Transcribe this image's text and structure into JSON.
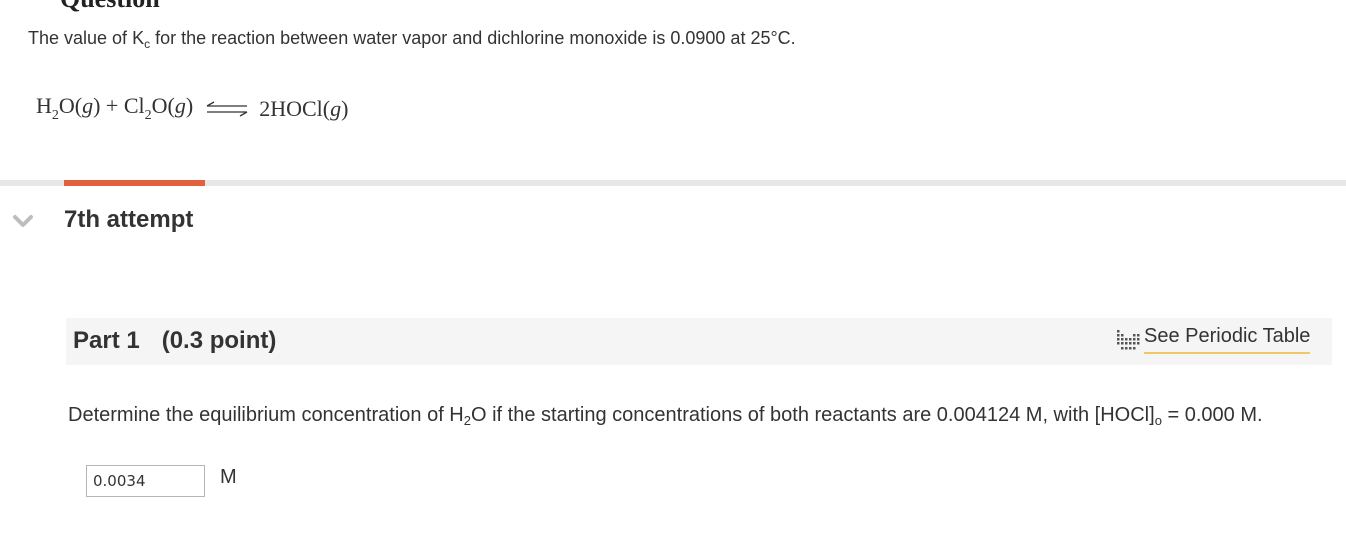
{
  "question_header": {
    "title": "Question"
  },
  "intro": {
    "text_before": "The value of K",
    "k_sub": "c",
    "text_after": " for the reaction between water vapor and dichlorine monoxide is 0.0900 at 25°C."
  },
  "equation": {
    "h": "H",
    "sub2a": "2",
    "o_g": "O(",
    "g1": "g",
    "close1": ") + Cl",
    "sub2b": "2",
    "o2": "O(",
    "g2": "g",
    "close2": ")",
    "product": "2HOCl(",
    "g3": "g",
    "close3": ")"
  },
  "attempt": {
    "label": "7th attempt",
    "progress": 0.12
  },
  "part": {
    "label": "Part 1",
    "points": "(0.3 point)",
    "periodic_table_link": "See Periodic Table"
  },
  "question": {
    "text1": "Determine the equilibrium concentration of H",
    "h2o_sub": "2",
    "text2": "O if the starting concentrations of both reactants are 0.004124  M, with [HOCl]",
    "hocl_sub": "o",
    "text3": " = 0.000 M."
  },
  "answer": {
    "value": "0.0034",
    "unit": "M"
  },
  "colors": {
    "accent": "#e3603d",
    "link_underline": "#f0c868",
    "part_bar": "#f5f5f5"
  },
  "icons": {
    "collapse": "chevron-down-icon",
    "periodic_table": "periodic-table-icon"
  }
}
